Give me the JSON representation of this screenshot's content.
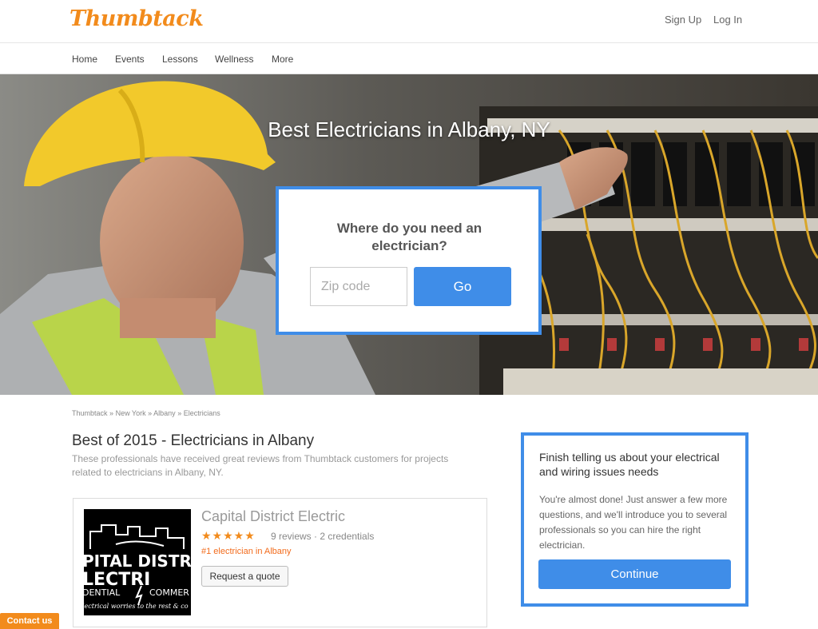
{
  "header": {
    "logo": "Thumbtack",
    "signup": "Sign Up",
    "login": "Log In"
  },
  "nav": {
    "items": [
      {
        "label": "Home"
      },
      {
        "label": "Events"
      },
      {
        "label": "Lessons"
      },
      {
        "label": "Wellness"
      },
      {
        "label": "More"
      }
    ]
  },
  "hero": {
    "title": "Best Electricians in Albany, NY",
    "question": "Where do you need an electrician?",
    "zip_placeholder": "Zip code",
    "zip_value": "",
    "go_label": "Go"
  },
  "breadcrumb": {
    "items": [
      "Thumbtack",
      "New York",
      "Albany",
      "Electricians"
    ],
    "separator": "»"
  },
  "main": {
    "title": "Best of 2015 - Electricians in Albany",
    "description": "These professionals have received great reviews from Thumbtack customers for projects related to electricians in Albany, NY."
  },
  "listing": {
    "name": "Capital District Electric",
    "rating": 5,
    "stars": "★★★★★",
    "reviews": "9 reviews · 2 credentials",
    "rank": "#1 electrician in Albany",
    "quote_label": "Request a quote",
    "logo_lines": [
      "PITAL DISTR",
      "LECTRI",
      "DENTIAL",
      "COMMER",
      "lectrical worries to the rest & co"
    ]
  },
  "sidebar": {
    "title": "Finish telling us about your electrical and wiring issues needs",
    "text": "You're almost done! Just answer a few more questions, and we'll introduce you to several professionals so you can hire the right electrician.",
    "continue_label": "Continue"
  },
  "contact": {
    "label": "Contact us"
  },
  "colors": {
    "brand_orange": "#f28b1c",
    "accent_blue": "#3f8de8",
    "rank_orange": "#f26b1c"
  }
}
